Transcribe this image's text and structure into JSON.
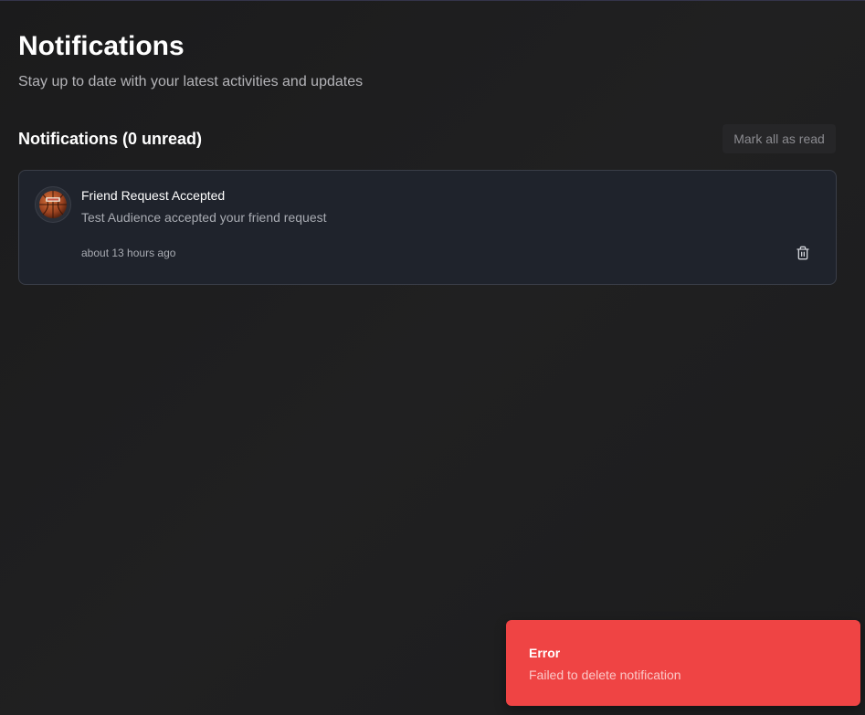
{
  "header": {
    "title": "Notifications",
    "subtitle": "Stay up to date with your latest activities and updates"
  },
  "section": {
    "title": "Notifications (0 unread)",
    "mark_all_label": "Mark all as read"
  },
  "notifications": [
    {
      "avatar_icon": "basketball-icon",
      "title": "Friend Request Accepted",
      "message": "Test Audience accepted your friend request",
      "time": "about 13 hours ago",
      "delete_icon": "trash-icon"
    }
  ],
  "toast": {
    "title": "Error",
    "message": "Failed to delete notification",
    "color": "#ef4444"
  }
}
